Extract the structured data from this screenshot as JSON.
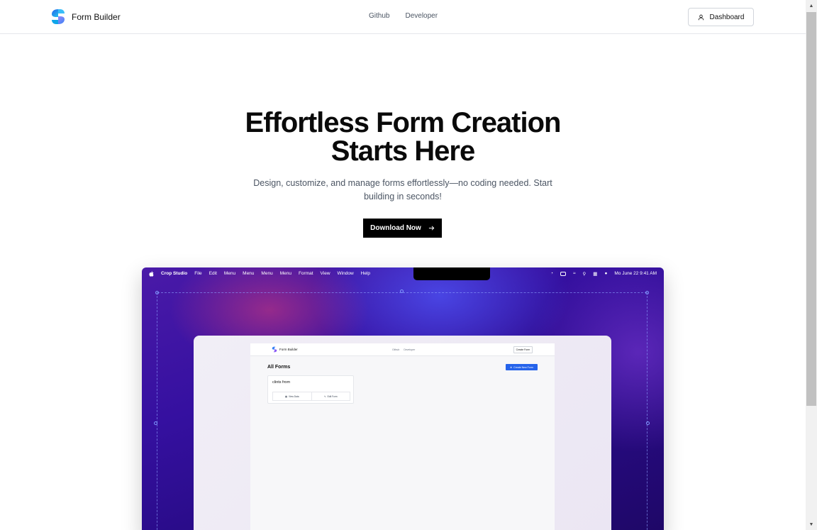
{
  "header": {
    "brand_name": "Form Builder",
    "nav": [
      "Github",
      "Developer"
    ],
    "dashboard_label": "Dashboard"
  },
  "hero": {
    "title_line1": "Effortless Form Creation",
    "title_line2": "Starts Here",
    "subtitle": "Design, customize, and manage forms effortlessly—no coding needed. Start building in seconds!",
    "download_label": "Download Now"
  },
  "mock": {
    "menubar": {
      "app": "Crop Studio",
      "items": [
        "File",
        "Edit",
        "Menu",
        "Menu",
        "Menu",
        "Menu",
        "Format",
        "View",
        "Window",
        "Help"
      ],
      "datetime": "Mo June 22  9:41 AM"
    },
    "inner": {
      "brand_name": "Form Builder",
      "nav": [
        "Github",
        "Developer"
      ],
      "create_label": "Create Form",
      "page_title": "All Forms",
      "new_form_label": "Create New Form",
      "card_title": "clints from",
      "view_label": "View Data",
      "edit_label": "Edit Form"
    }
  },
  "colors": {
    "primary_button": "#000000",
    "accent_blue": "#2563eb",
    "wallpaper": "#3510a0"
  }
}
